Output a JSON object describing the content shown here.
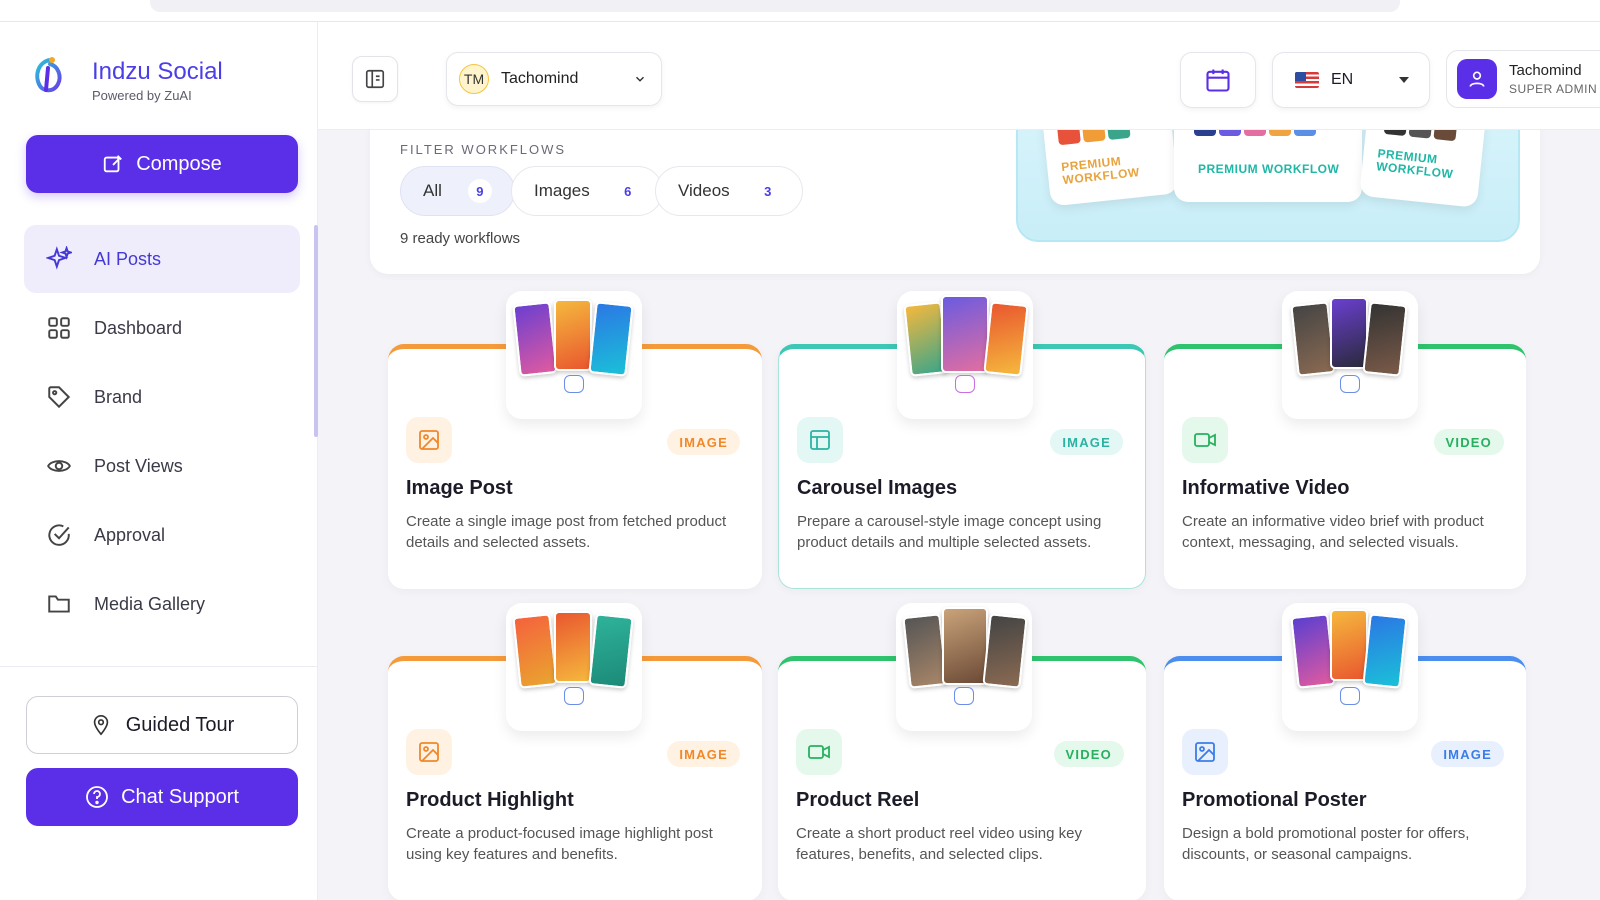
{
  "brand": {
    "name": "Indzu Social",
    "tagline": "Powered by ZuAI"
  },
  "sidebar": {
    "compose_label": "Compose",
    "items": [
      {
        "label": "AI Posts",
        "icon": "sparkles-icon",
        "active": true
      },
      {
        "label": "Dashboard",
        "icon": "grid-icon",
        "active": false
      },
      {
        "label": "Brand",
        "icon": "tag-icon",
        "active": false
      },
      {
        "label": "Post Views",
        "icon": "eye-icon",
        "active": false
      },
      {
        "label": "Approval",
        "icon": "check-circle-icon",
        "active": false
      },
      {
        "label": "Media Gallery",
        "icon": "folder-icon",
        "active": false
      }
    ],
    "guided_tour_label": "Guided Tour",
    "chat_support_label": "Chat Support"
  },
  "header": {
    "workspace": {
      "initials": "TM",
      "name": "Tachomind"
    },
    "language": "EN",
    "user": {
      "name": "Tachomind",
      "role": "SUPER ADMIN"
    }
  },
  "filter": {
    "title": "FILTER WORKFLOWS",
    "chips": [
      {
        "label": "All",
        "count": "9",
        "active": true
      },
      {
        "label": "Images",
        "count": "6",
        "active": false
      },
      {
        "label": "Videos",
        "count": "3",
        "active": false
      }
    ],
    "ready_text": "9 ready workflows",
    "premium_labels": [
      "PREMIUM WORKFLOW",
      "PREMIUM WORKFLOW",
      "PREMIUM WORKFLOW"
    ]
  },
  "workflows": [
    {
      "title": "Image Post",
      "type": "IMAGE",
      "accent": "#f59a3a",
      "desc": "Create a single image post from fetched product details and selected assets."
    },
    {
      "title": "Carousel Images",
      "type": "IMAGE",
      "accent": "#3cc8b4",
      "desc": "Prepare a carousel-style image concept using product details and multiple selected assets."
    },
    {
      "title": "Informative Video",
      "type": "VIDEO",
      "accent": "#2fc36d",
      "desc": "Create an informative video brief with product context, messaging, and selected visuals."
    },
    {
      "title": "Product Highlight",
      "type": "IMAGE",
      "accent": "#f59a3a",
      "desc": "Create a product-focused image highlight post using key features and benefits."
    },
    {
      "title": "Product Reel",
      "type": "VIDEO",
      "accent": "#2fc36d",
      "desc": "Create a short product reel video using key features, benefits, and selected clips."
    },
    {
      "title": "Promotional Poster",
      "type": "IMAGE",
      "accent": "#4b8ef0",
      "desc": "Design a bold promotional poster for offers, discounts, or seasonal campaigns."
    }
  ],
  "colors": {
    "primary": "#5b2ee8",
    "active_nav_bg": "#efedfb",
    "image_badge_bg": "#fff2e3",
    "image_badge_text": "#f0882a",
    "video_badge_bg": "#e4f8ec",
    "video_badge_text": "#27b05f"
  }
}
